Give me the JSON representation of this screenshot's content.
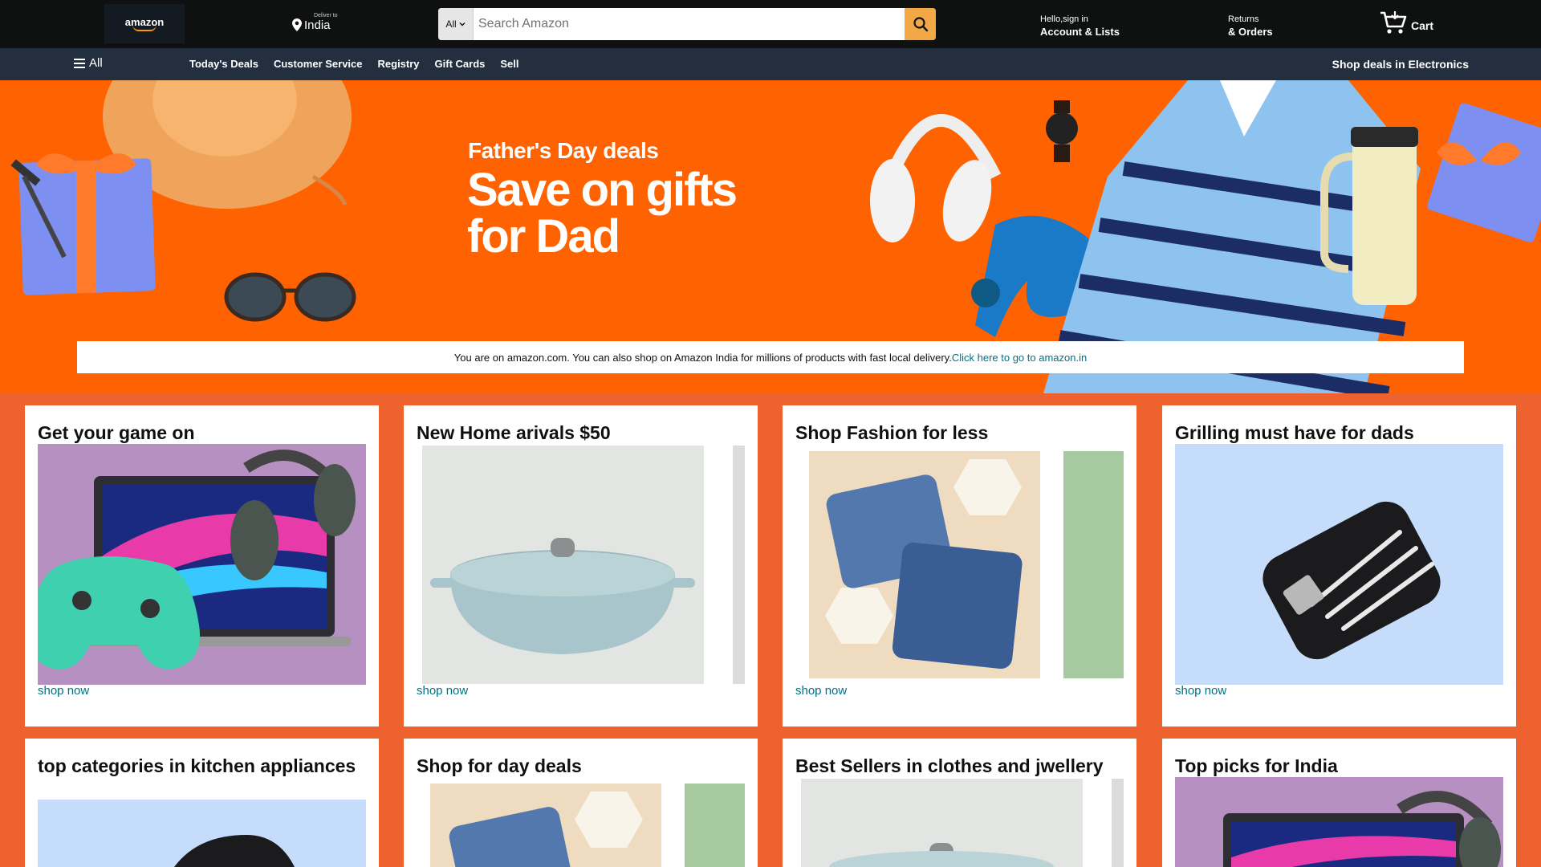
{
  "header": {
    "logo_text": "amazon",
    "deliver_small": "Deliver to",
    "deliver_location": "India",
    "search_category": "All",
    "search_placeholder": "Search Amazon",
    "account_line1": "Hello,sign in",
    "account_line2": "Account & Lists",
    "returns_line1": "Returns",
    "returns_line2": "& Orders",
    "cart_label": "Cart"
  },
  "subnav": {
    "all_label": "All",
    "links": [
      "Today's Deals",
      "Customer Service",
      "Registry",
      "Gift Cards",
      "Sell"
    ],
    "right_label": "Shop deals in Electronics"
  },
  "hero": {
    "subtitle": "Father's Day deals",
    "title": "Save on gifts for Dad"
  },
  "notice": {
    "text": "You are on amazon.com. You can also shop on Amazon India for millions of products with fast local delivery.",
    "link": "Click here to go to amazon.in"
  },
  "cards": [
    {
      "title": "Get your game on",
      "link": "shop now"
    },
    {
      "title": "New Home arivals $50",
      "link": "shop now"
    },
    {
      "title": "Shop Fashion for less",
      "link": "shop now"
    },
    {
      "title": "Grilling must have for dads",
      "link": "shop now"
    },
    {
      "title": "top categories in kitchen appliances"
    },
    {
      "title": "Shop for day deals"
    },
    {
      "title": "Best Sellers in clothes and jwellery"
    },
    {
      "title": "Top picks for India"
    }
  ],
  "colors": {
    "nav_top": "#0f1111",
    "nav_sub": "#232f3e",
    "hero_bg": "#ff6200",
    "page_bg": "#ee6230",
    "search_button": "#f3a847",
    "link": "#007185"
  }
}
